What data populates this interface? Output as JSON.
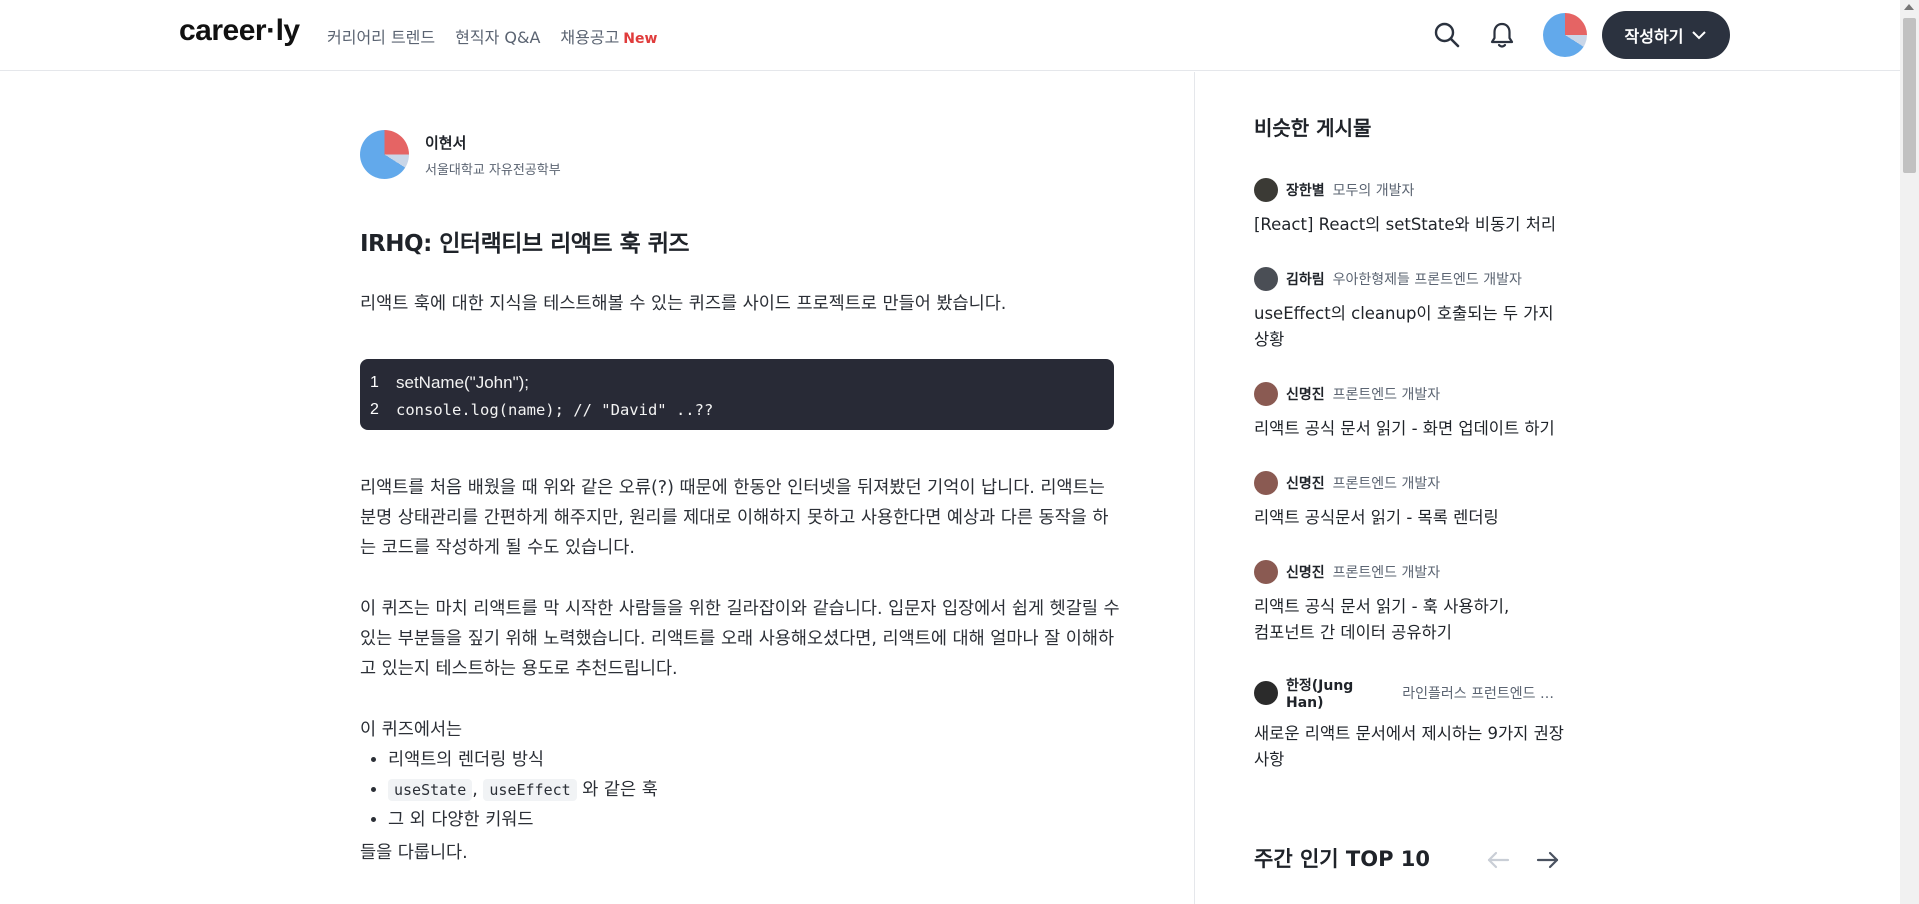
{
  "header": {
    "logo": "career·ly",
    "nav": [
      {
        "label": "커리어리 트렌드"
      },
      {
        "label": "현직자 Q&A"
      },
      {
        "label": "채용공고",
        "badge": "New"
      }
    ],
    "write_button": "작성하기"
  },
  "article": {
    "author": {
      "name": "이현서",
      "description": "서울대학교 자유전공학부"
    },
    "title": "IRHQ: 인터랙티브 리액트 훅 퀴즈",
    "intro": "리액트 훅에 대한 지식을 테스트해볼 수 있는 퀴즈를 사이드 프로젝트로 만들어 봤습니다.",
    "code": [
      {
        "line": "1",
        "text": "setName(\"John\");"
      },
      {
        "line": "2",
        "text": "console.log(name); // \"David\" ..??"
      }
    ],
    "p2": "리액트를 처음 배웠을 때 위와 같은 오류(?) 때문에 한동안 인터넷을 뒤져봤던 기억이 납니다. 리액트는 분명 상태관리를 간편하게 해주지만, 원리를 제대로 이해하지 못하고 사용한다면 예상과 다른 동작을 하는 코드를 작성하게 될 수도 있습니다.",
    "p3": "이 퀴즈는 마치 리액트를 막 시작한 사람들을 위한 길라잡이와 같습니다. 입문자 입장에서 쉽게 헷갈릴 수 있는 부분들을 짚기 위해 노력했습니다. 리액트를 오래 사용해오셨다면, 리액트에 대해 얼마나 잘 이해하고 있는지 테스트하는 용도로 추천드립니다.",
    "p4": "이 퀴즈에서는",
    "list": {
      "item1": "리액트의 렌더링 방식",
      "item2_code1": "useState",
      "item2_sep": ",",
      "item2_code2": "useEffect",
      "item2_rest": "와 같은 훅",
      "item3": "그 외 다양한 키워드"
    },
    "outro": "들을 다룹니다."
  },
  "sidebar": {
    "title": "비슷한 게시물",
    "related": [
      {
        "name": "장한별",
        "role": "모두의 개발자",
        "title": "[React] React의 setState와 비동기 처리",
        "avatar_color": "#3b3a35"
      },
      {
        "name": "김하림",
        "role": "우아한형제들 프론트엔드 개발자",
        "title": "useEffect의 cleanup이 호출되는 두 가지 상황",
        "avatar_color": "#4a4e55"
      },
      {
        "name": "신명진",
        "role": "프론트엔드 개발자",
        "title": "리액트 공식 문서 읽기 - 화면 업데이트 하기",
        "avatar_color": "#8a5a52"
      },
      {
        "name": "신명진",
        "role": "프론트엔드 개발자",
        "title": "리액트 공식문서 읽기 - 목록 렌더링",
        "avatar_color": "#8a5a52"
      },
      {
        "name": "신명진",
        "role": "프론트엔드 개발자",
        "title": "리액트 공식 문서 읽기 - 훅 사용하기, 컴포넌트 간 데이터 공유하기",
        "avatar_color": "#8a5a52"
      },
      {
        "name": "한정(Jung Han)",
        "role": "라인플러스 프런트엔드 개...",
        "title": "새로운 리액트 문서에서 제시하는 9가지 권장 사항",
        "avatar_color": "#2b2b2b"
      }
    ],
    "top10_title": "주간 인기 TOP 10"
  }
}
